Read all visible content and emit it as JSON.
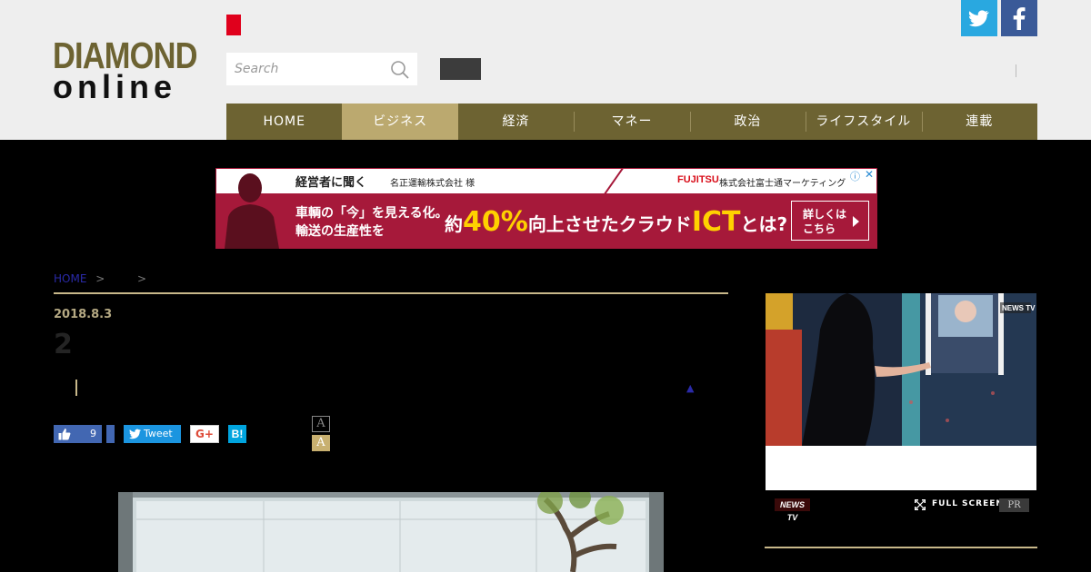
{
  "header": {
    "logo_line1": "DIAMOND",
    "logo_line2": "online",
    "search_placeholder": "Search"
  },
  "nav": {
    "items": [
      {
        "label": "HOME",
        "active": false
      },
      {
        "label": "ビジネス",
        "active": true
      },
      {
        "label": "経済",
        "active": false
      },
      {
        "label": "マネー",
        "active": false
      },
      {
        "label": "政治",
        "active": false
      },
      {
        "label": "ライフスタイル",
        "active": false
      },
      {
        "label": "連載",
        "active": false
      }
    ]
  },
  "ad": {
    "line1": "経営者に聞く",
    "line2": "名正運輸株式会社 様",
    "fujitsu": "FUJITSU",
    "fujitsu_company": "株式会社富士通マーケティング",
    "info": "ⓘ",
    "close": "✕",
    "headline1": "車輌の「今」を見える化。",
    "headline2": "輸送の生産性を",
    "big_prefix": "約",
    "big_num": "40%",
    "big_mid": "向上させたクラウド",
    "big_ict": "ICT",
    "big_suffix": "とは?",
    "cta_line1": "詳しくは",
    "cta_line2": "こちら"
  },
  "breadcrumb": {
    "home": "HOME",
    "sep1": ">",
    "sep2": ">"
  },
  "article": {
    "date": "2018.8.3",
    "title": "2",
    "up_arrow": "▲"
  },
  "share": {
    "like_count": "9",
    "tweet_label": "Tweet",
    "gplus_label": "G+",
    "hatena_label": "B!",
    "font_small": "A",
    "font_large": "A"
  },
  "video": {
    "brand": "NEWS TV",
    "fullscreen_label": "FULL SCREEN",
    "pr_label": "PR"
  },
  "colors": {
    "nav_bg": "#6d6332",
    "nav_active": "#bba96f",
    "accent_rule": "#c8b88a",
    "ad_bg": "#a6193a",
    "twitter": "#29a8e0",
    "facebook": "#3a5a98"
  }
}
